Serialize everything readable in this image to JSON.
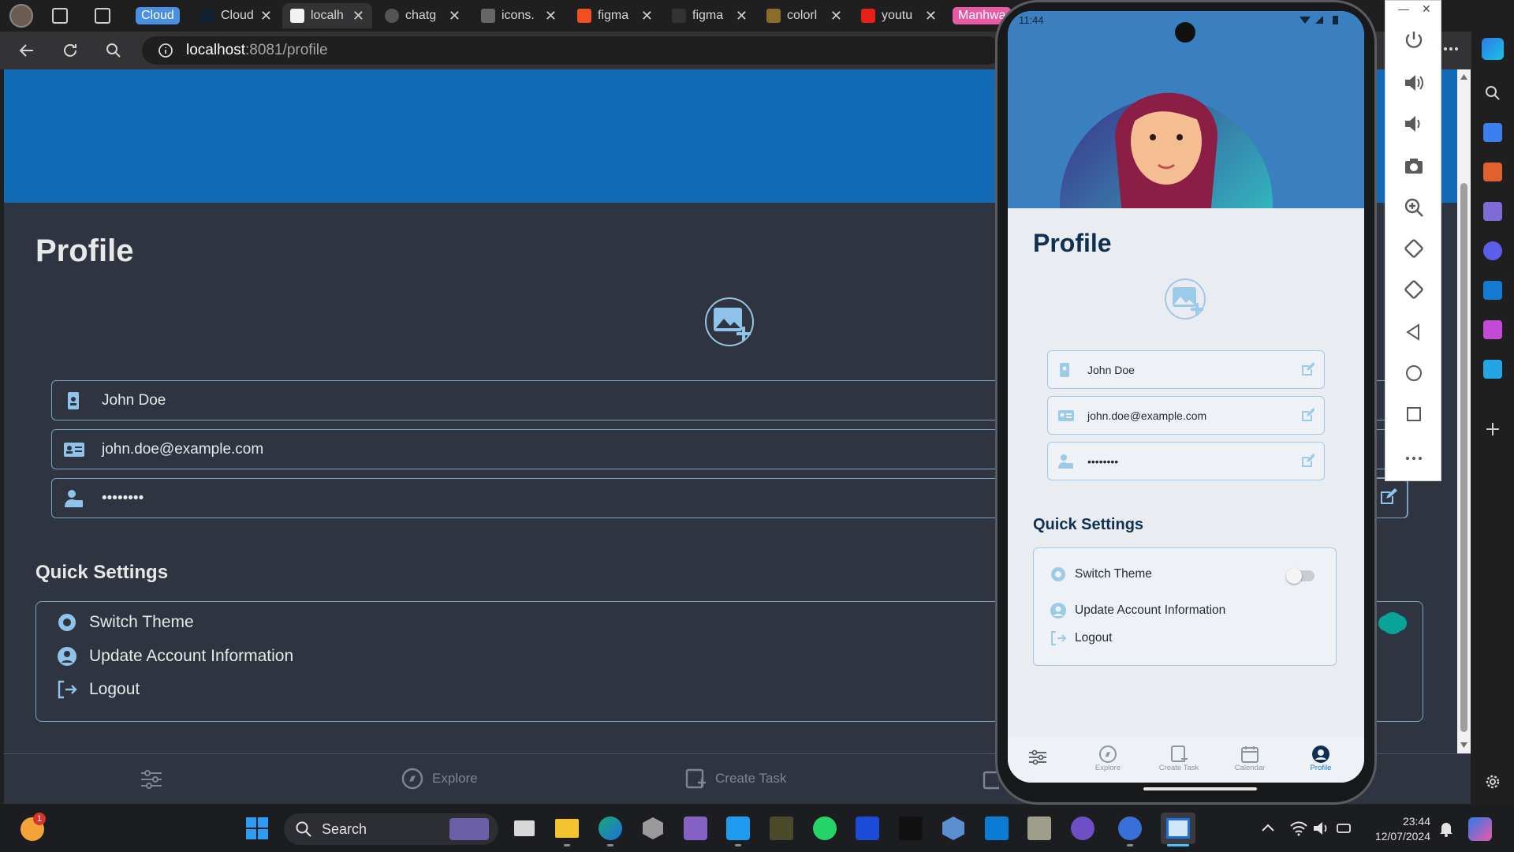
{
  "browser": {
    "tab_group_left": "Cloud",
    "tab_group_right": "Manhwa",
    "tabs": [
      {
        "label": "Cloud",
        "icon": "mongodb-icon"
      },
      {
        "label": "localh",
        "icon": "expo-icon",
        "active": true
      },
      {
        "label": "chatg",
        "icon": "chatgpt-icon"
      },
      {
        "label": "icons.",
        "icon": "icons-icon"
      },
      {
        "label": "figma",
        "icon": "figma-icon"
      },
      {
        "label": "figma",
        "icon": "play-icon"
      },
      {
        "label": "colorl",
        "icon": "colorlib-icon"
      },
      {
        "label": "youtu",
        "icon": "youtube-icon"
      }
    ],
    "url_host": "localhost",
    "url_path": ":8081/profile"
  },
  "web": {
    "title": "Profile",
    "fields": [
      {
        "icon": "id-badge-icon",
        "value": "John Doe"
      },
      {
        "icon": "contact-card-icon",
        "value": "john.doe@example.com"
      },
      {
        "icon": "user-lock-icon",
        "value": "••••••••"
      }
    ],
    "quick_settings": {
      "title": "Quick Settings",
      "items": [
        "Switch Theme",
        "Update Account Information",
        "Logout"
      ]
    },
    "nav": [
      "Explore",
      "Create Task"
    ]
  },
  "phone": {
    "status_time": "11:44",
    "title": "Profile",
    "fields": [
      {
        "icon": "id-badge-icon",
        "value": "John Doe"
      },
      {
        "icon": "contact-card-icon",
        "value": "john.doe@example.com"
      },
      {
        "icon": "user-lock-icon",
        "value": "••••••••"
      }
    ],
    "quick_settings": {
      "title": "Quick Settings",
      "items": [
        "Switch Theme",
        "Update Account Information",
        "Logout"
      ],
      "theme_toggle_on": false
    },
    "nav": [
      "",
      "Explore",
      "Create Task",
      "Calendar",
      "Profile"
    ]
  },
  "taskbar": {
    "search_placeholder": "Search",
    "time": "23:44",
    "date": "12/07/2024",
    "badge": "1"
  },
  "colors": {
    "web_banner": "#116ab3",
    "web_bg": "#2e3541",
    "phone_header": "#3a7fbf",
    "accent": "#0aa39a"
  }
}
